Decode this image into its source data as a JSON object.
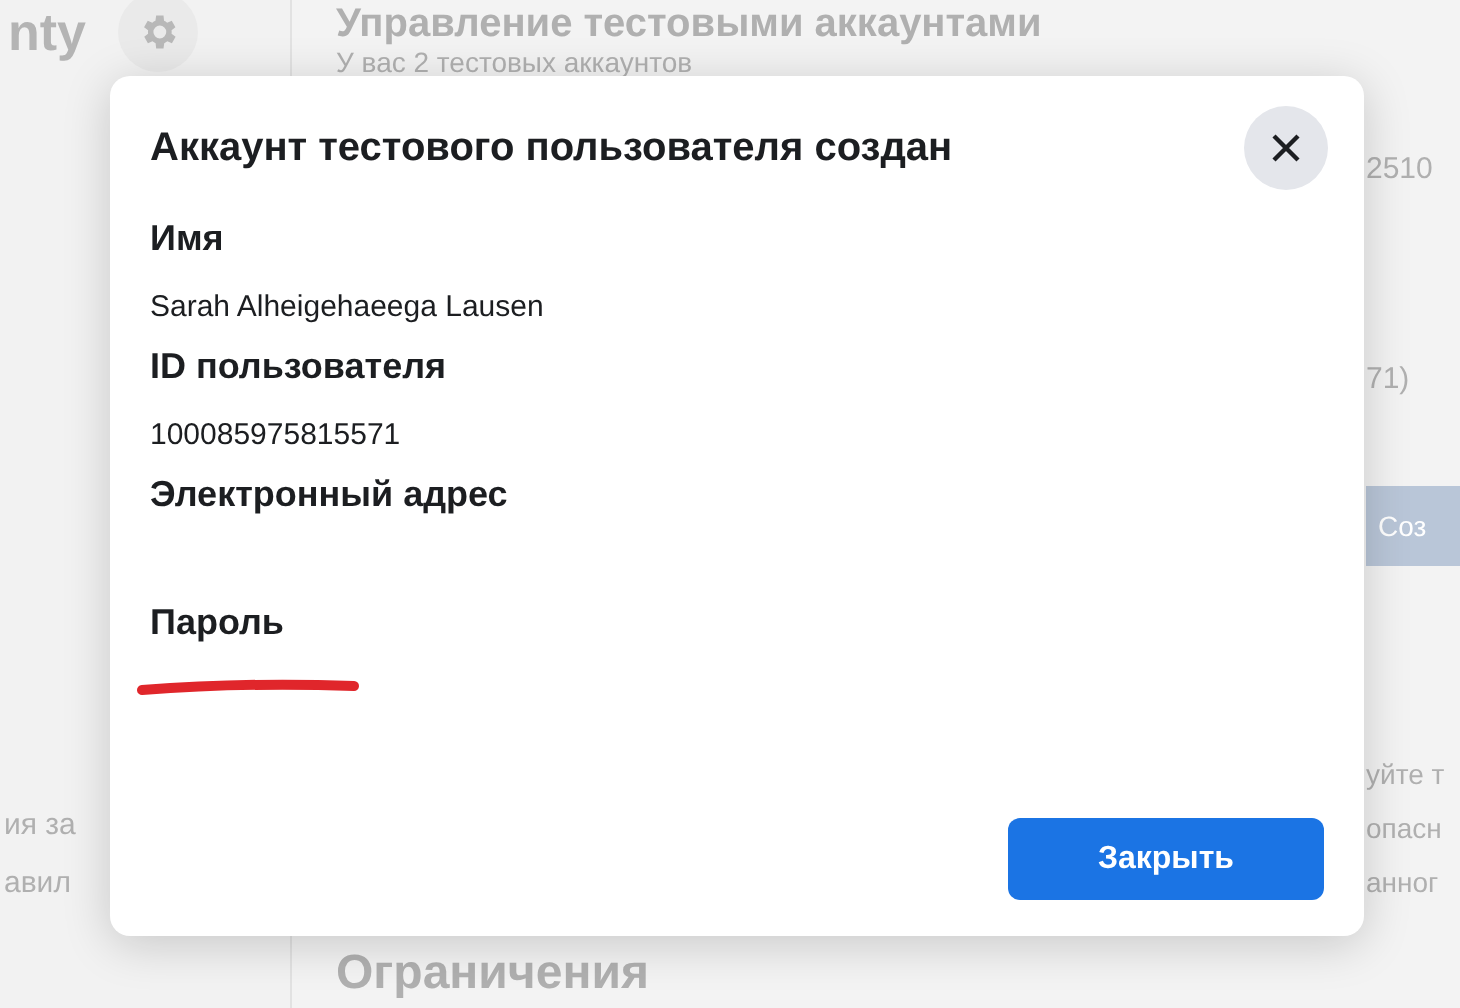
{
  "background": {
    "sidebar_title": "nty",
    "sidebar_texts": [
      "ия за",
      "авил"
    ],
    "page_title": "Управление тестовыми аккаунтами",
    "page_subtitle": "У вас 2 тестовых аккаунтов",
    "right_texts": [
      "2510",
      "71)"
    ],
    "create_button": "Соз",
    "right_paragraph": [
      "уйте т",
      "опасн",
      "анног"
    ],
    "section_title": "Ограничения"
  },
  "dialog": {
    "title": "Аккаунт тестового пользователя создан",
    "fields": [
      {
        "label": "Имя",
        "value": "Sarah Alheigehaeega Lausen",
        "redacted": false
      },
      {
        "label": "ID пользователя",
        "value": "100085975815571",
        "redacted": false
      },
      {
        "label": "Электронный адрес"
      },
      {
        "label": "Пароль",
        "redacted": true
      }
    ],
    "close_button": "Закрыть"
  }
}
